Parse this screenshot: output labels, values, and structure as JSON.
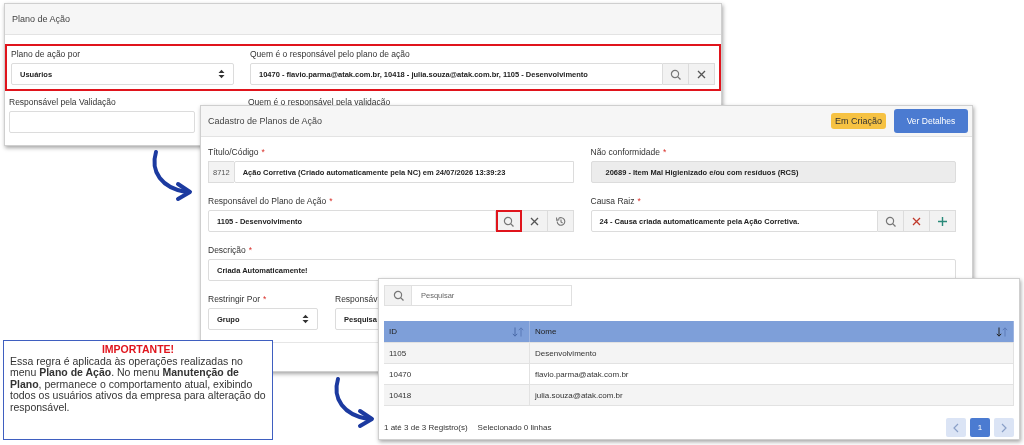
{
  "plan_panel": {
    "title": "Plano de Ação",
    "highlighted_row": {
      "highlighted": true,
      "fields": [
        {
          "kind": "select",
          "label": "Plano de ação por",
          "value": "Usuários"
        },
        {
          "kind": "lookup",
          "label": "Quem é o responsável pelo plano de ação",
          "value": "10470 - flavio.parma@atak.com.br, 10418 - julia.souza@atak.com.br, 1105 - Desenvolvimento",
          "buttons": [
            {
              "kind": "search",
              "highlighted": false
            },
            {
              "kind": "clear",
              "highlighted": false
            }
          ]
        }
      ]
    },
    "validation_row": {
      "fields": [
        {
          "label": "Responsável pela Validação"
        },
        {
          "label": "Quem é o responsável pela validação"
        }
      ]
    }
  },
  "register_panel": {
    "title": "Cadastro de Planos de Ação",
    "status_badge": "Em Criação",
    "details_button": "Ver Detalhes",
    "rows": [
      [
        {
          "kind": "text",
          "label": "Título/Código",
          "required_mark": "*",
          "prefix": "8712",
          "value": "Ação Corretiva (Criado automaticamente pela NC) em 24/07/2026 13:39:23"
        },
        {
          "kind": "readonly",
          "label": "Não conformidade",
          "required_mark": "*",
          "value": "20689 - Item Mal Higienizado e/ou com resíduos (RCS)"
        }
      ],
      [
        {
          "kind": "lookup",
          "label": "Responsável do Plano de Ação",
          "required_mark": "*",
          "value": "1105 - Desenvolvimento",
          "buttons": [
            {
              "kind": "search",
              "highlighted": true
            },
            {
              "kind": "clear",
              "highlighted": false
            },
            {
              "kind": "history",
              "highlighted": false
            }
          ]
        },
        {
          "kind": "lookup",
          "label": "Causa Raiz",
          "required_mark": "*",
          "value": "24 - Causa criada automaticamente pela Ação Corretiva.",
          "buttons": [
            {
              "kind": "search",
              "highlighted": false
            },
            {
              "kind": "clear-red",
              "highlighted": false
            },
            {
              "kind": "add",
              "highlighted": false
            }
          ]
        }
      ],
      [
        {
          "kind": "text",
          "label": "Descrição",
          "required_mark": "*",
          "value": "Criada Automaticamente!"
        }
      ],
      [
        {
          "kind": "select",
          "label": "Restringir Por",
          "required_mark": "*",
          "value": "Grupo"
        },
        {
          "kind": "cut",
          "label": "Responsáv",
          "value": "Pesquisa"
        }
      ]
    ]
  },
  "lookup_dialog": {
    "search": {
      "placeholder": "Pesquisar"
    },
    "columns": [
      {
        "label": "ID",
        "sorted": false
      },
      {
        "label": "Nome",
        "sorted": true
      }
    ],
    "rows": [
      [
        "1105",
        "Desenvolvimento"
      ],
      [
        "10470",
        "flavio.parma@atak.com.br"
      ],
      [
        "10418",
        "julia.souza@atak.com.br"
      ]
    ],
    "records_info": "1 até 3 de 3 Registro(s)",
    "selection_info": "Selecionado 0 linhas",
    "pages": [
      {
        "label": "1",
        "selected": true
      }
    ]
  },
  "note": {
    "title": "IMPORTANTE!",
    "text": "Essa regra é aplicada às operações realizadas no menu **Plano de Ação**. No menu **Manutenção de Plano**, permanece o comportamento atual, exibindo todos os usuários ativos da empresa para alteração do responsável."
  }
}
